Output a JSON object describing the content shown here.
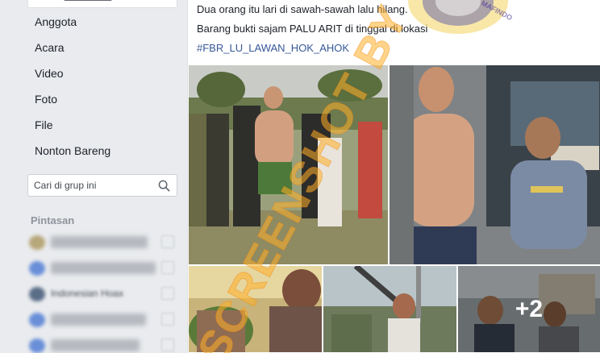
{
  "sidebar": {
    "nav_items": [
      {
        "label": "Anggota"
      },
      {
        "label": "Acara"
      },
      {
        "label": "Video"
      },
      {
        "label": "Foto"
      },
      {
        "label": "File"
      },
      {
        "label": "Nonton Bareng"
      }
    ],
    "search": {
      "placeholder": "Cari di grup ini",
      "icon": "search-icon"
    },
    "shortcuts_title": "Pintasan",
    "shortcuts": [
      {
        "label": "",
        "icon_color": "#b8a77a"
      },
      {
        "label": "",
        "icon_color": "#6a8fd8"
      },
      {
        "label": "Indonesian Hoax",
        "icon_color": "#5b6e88"
      },
      {
        "label": "",
        "icon_color": "#6a8fd8"
      },
      {
        "label": "",
        "icon_color": "#6a8fd8"
      }
    ]
  },
  "post": {
    "lines": [
      "Dua orang itu lari di sawah-sawah lalu hilang.",
      "Barang bukti sajam PALU ARIT di tinggal di lokasi"
    ],
    "hashtag": "#FBR_LU_LAWAN_HOK_AHOK",
    "logo_text": "MAFINDO",
    "photos": [
      {
        "name": "photo-crowd"
      },
      {
        "name": "photo-injured-men"
      },
      {
        "name": "photo-injured-closeup"
      },
      {
        "name": "photo-street-scene"
      },
      {
        "name": "photo-more"
      }
    ],
    "more_count": "+2",
    "watermark": "SCREENSHOT BY"
  },
  "colors": {
    "background": "#e9ebee",
    "link": "#365899",
    "text": "#1d2129",
    "watermark": "#ffb028"
  }
}
